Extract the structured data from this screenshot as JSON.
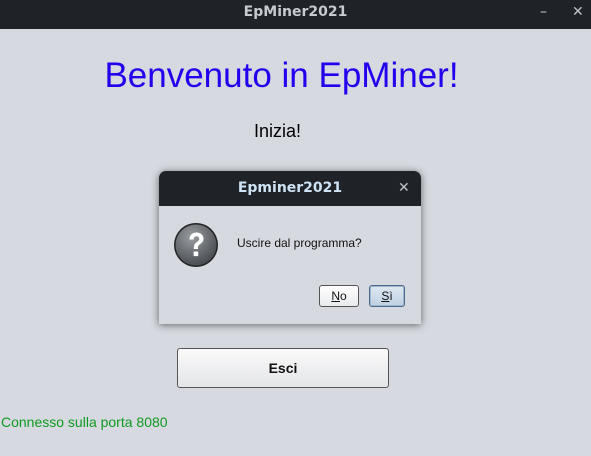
{
  "window": {
    "title": "EpMiner2021",
    "minimize_glyph": "–",
    "close_glyph": "✕"
  },
  "main": {
    "heading": "Benvenuto in EpMiner!",
    "start_label": "Inizia!",
    "exit_button": "Esci",
    "status": "Connesso sulla porta 8080"
  },
  "dialog": {
    "title": "Epminer2021",
    "close_glyph": "✕",
    "icon": "question-icon",
    "message": "Uscire dal programma?",
    "no_mnemonic": "N",
    "no_rest": "o",
    "yes_mnemonic": "S",
    "yes_rest": "ì"
  },
  "colors": {
    "heading": "#2200ee",
    "status": "#119922",
    "titlebar": "#1f2328",
    "background": "#d6d9e0"
  }
}
